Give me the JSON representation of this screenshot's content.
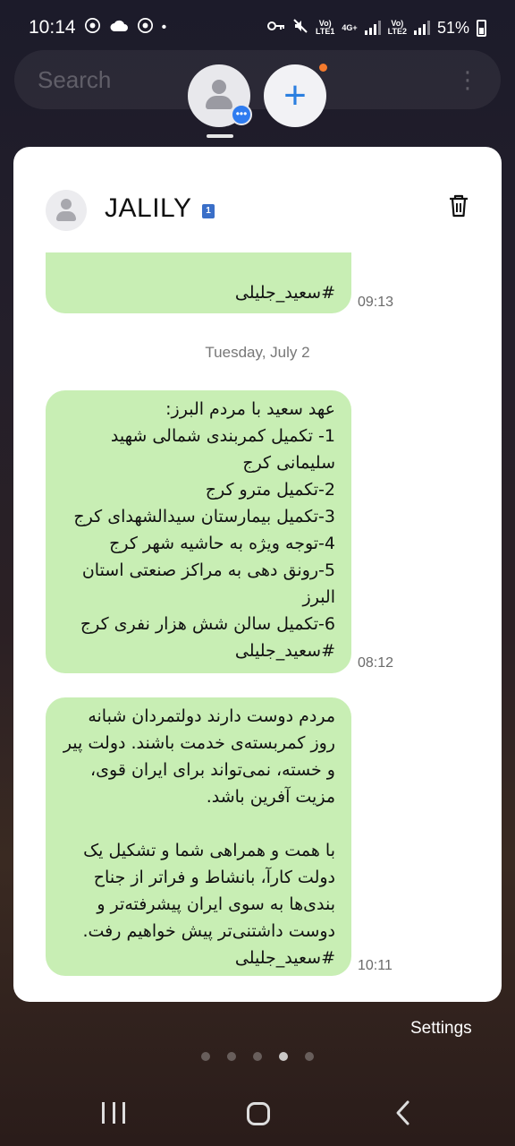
{
  "status_bar": {
    "time": "10:14",
    "sim1_tag": "Vo)\nLTE1",
    "network_tag": "4G+",
    "sim2_tag": "Vo)\nLTE2",
    "battery": "51%"
  },
  "search": {
    "placeholder": "Search"
  },
  "conversation": {
    "contact_name": "JALILY",
    "sim_badge": "1",
    "messages": [
      {
        "text": "#سعید_جلیلی",
        "time": "09:13"
      },
      {
        "text": "عهد سعید با مردم البرز:\n1- تکمیل کمربندی شمالی شهید سلیمانی کرج\n2-تکمیل مترو کرج\n3-تکمیل بیمارستان سیدالشهدای کرج\n4-توجه ویژه به حاشیه شهر کرج\n5-رونق دهی به مراکز صنعتی استان البرز\n6-تکمیل سالن شش هزار نفری کرج\n#سعید_جلیلی",
        "time": "08:12"
      },
      {
        "text": "مردم دوست دارند دولتمردان شبانه روز کمربسته‌ی خدمت باشند. دولت پیر و خسته، نمی‌تواند برای ایران قوی، مزیت آفرین باشد.\n\nبا همت و همراهی شما و تشکیل یک دولت کارآ، بانشاط و فراتر از جناح بندی‌ها به سوی ایران پیشرفته‌تر و دوست داشتنی‌تر پیش خواهیم رفت.\n#سعید_جلیلی",
        "time": "10:11"
      }
    ],
    "date_separator": "Tuesday, July 2"
  },
  "settings_label": "Settings",
  "pager": {
    "count": 5,
    "active_index": 3
  },
  "colors": {
    "bubble": "#c8eeb4",
    "accent": "#2b7fe0",
    "badge": "#f47a2d"
  }
}
